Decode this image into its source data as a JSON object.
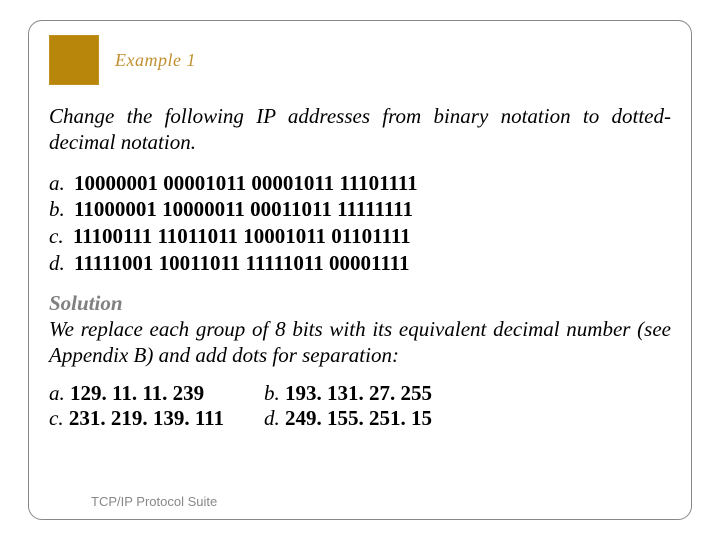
{
  "header": {
    "title": "Example 1"
  },
  "question": "Change the following IP addresses from binary notation to dotted-decimal notation.",
  "items": {
    "a": {
      "label": "a.",
      "binary": "10000001 00001011 00001011 11101111"
    },
    "b": {
      "label": "b.",
      "binary": "11000001 10000011 00011011 11111111"
    },
    "c": {
      "label": "c.",
      "binary": "11100111 11011011 10001011 01101111"
    },
    "d": {
      "label": "d.",
      "binary": "11111001 10011011 11111011 00001111"
    }
  },
  "solution": {
    "heading": "Solution",
    "text": "We replace each group of 8 bits with its equivalent decimal number (see Appendix B) and add dots for separation:"
  },
  "answers": {
    "a": {
      "label": "a.",
      "value": "129. 11. 11. 239"
    },
    "b": {
      "label": "b.",
      "value": "193. 131. 27. 255"
    },
    "c": {
      "label": "c.",
      "value": "231. 219. 139. 111"
    },
    "d": {
      "label": "d.",
      "value": " 249. 155. 251. 15"
    }
  },
  "footer": "TCP/IP Protocol Suite"
}
